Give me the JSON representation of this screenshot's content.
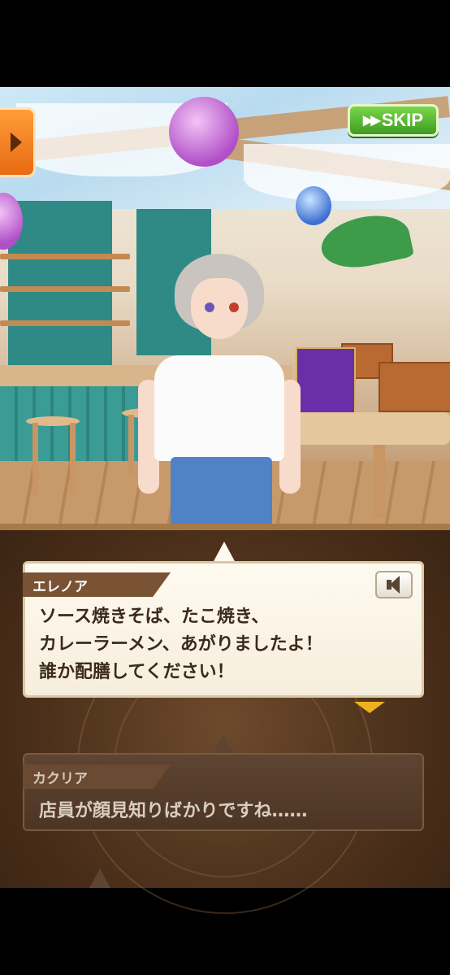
{
  "controls": {
    "skip_label": "SKIP",
    "skip_icon": "fast-forward-icon",
    "menu_icon": "arrow-right-icon",
    "voice_icon": "speaker-icon"
  },
  "dialogue_current": {
    "speaker": "エレノア",
    "text": "ソース焼きそば、たこ焼き、\nカレーラーメン、あがりましたよ！\n誰か配膳してください！"
  },
  "dialogue_previous": {
    "speaker": "カクリア",
    "text": "店員が顔見知りばかりですね……"
  },
  "colors": {
    "skip_button": "#4caf2a",
    "menu_button": "#f28226",
    "panel": "#4c301b",
    "next_indicator": "#f0b020"
  }
}
